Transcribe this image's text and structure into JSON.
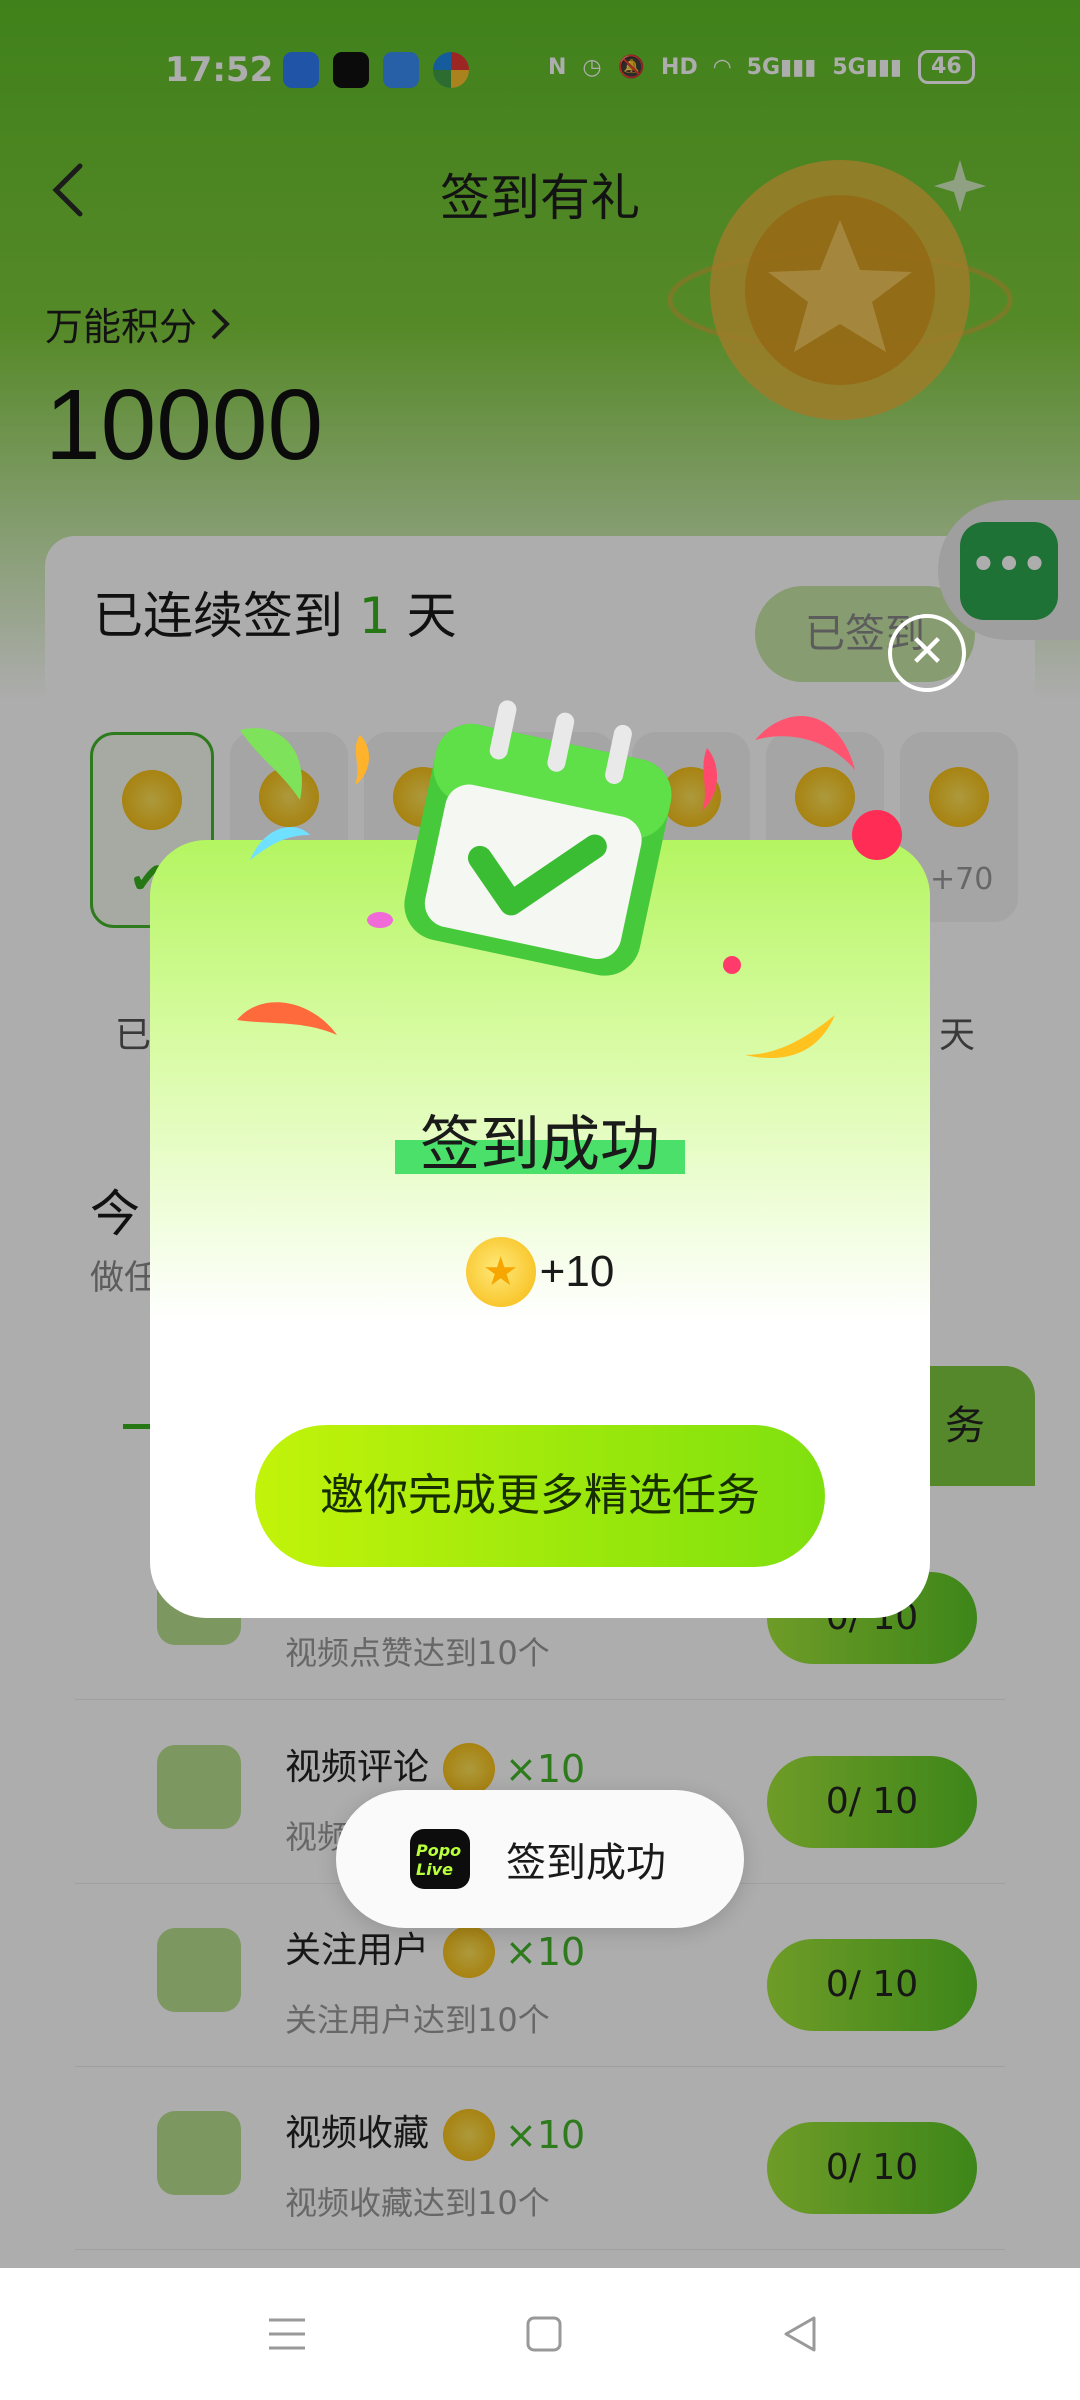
{
  "status_bar": {
    "time": "17:52",
    "app_icons": [
      "blue-app-icon",
      "tiktok-icon",
      "bank-app-icon",
      "colorful-app-icon"
    ],
    "system_icons": [
      "nfc-icon",
      "alarm-icon",
      "mute-icon",
      "hd-icon",
      "wifi-icon",
      "5g-signal-icon",
      "5g-signal-icon"
    ],
    "network1": "5G",
    "network2": "5G",
    "battery": "46"
  },
  "header": {
    "title": "签到有礼",
    "points_label": "万能积分",
    "points_value": "10000"
  },
  "streak_card": {
    "prefix": "已连续签到",
    "count": "1",
    "suffix": "天",
    "signed_button": "已签到",
    "day7_bonus": "+70",
    "first_day_label": "已",
    "last_day_label": "天"
  },
  "today_card": {
    "title": "今",
    "subtitle": "做任"
  },
  "tasks_tab": {
    "right_tab_label": "务"
  },
  "tasks": [
    {
      "name": "",
      "reward": "",
      "desc": "视频点赞达到10个",
      "progress": "0/ 10",
      "icon": "live-icon"
    },
    {
      "name": "视频评论",
      "reward": "×10",
      "desc": "视频评",
      "progress": "0/ 10",
      "icon": "video-comment-icon"
    },
    {
      "name": "关注用户",
      "reward": "×10",
      "desc": "关注用户达到10个",
      "progress": "0/ 10",
      "icon": "follow-user-icon"
    },
    {
      "name": "视频收藏",
      "reward": "×10",
      "desc": "视频收藏达到10个",
      "progress": "0/ 10",
      "icon": "gift-star-icon"
    }
  ],
  "popup": {
    "title": "签到成功",
    "reward": "+10",
    "cta": "邀你完成更多精选任务",
    "close_icon": "close-icon",
    "illustration": "calendar-check-icon"
  },
  "toast": {
    "app_badge": "Popo Live",
    "text": "签到成功"
  },
  "nav_bar": {
    "buttons": [
      "menu-icon",
      "home-square-icon",
      "back-triangle-icon"
    ]
  },
  "colors": {
    "brand_green": "#37b11c",
    "popup_top": "#b4f561",
    "cta_start": "#c2f30a",
    "cta_end": "#7fe00e"
  }
}
